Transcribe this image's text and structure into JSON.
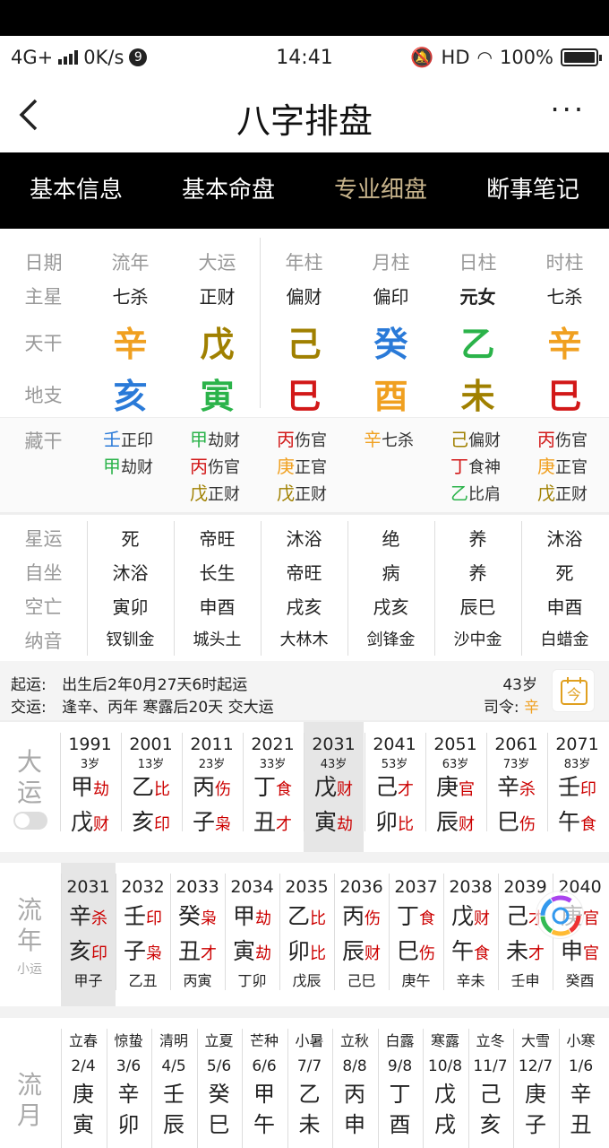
{
  "status": {
    "network": "4G+",
    "speed": "0K/s",
    "badge": "9",
    "time": "14:41",
    "hd": "HD",
    "battery": "100%"
  },
  "header": {
    "title": "八字排盘",
    "back": "<",
    "more": "···"
  },
  "tabs": [
    "基本信息",
    "基本命盘",
    "专业细盘",
    "断事笔记"
  ],
  "colors": {
    "active_tab": "#c8b48c",
    "metal": "#f0a020",
    "earth": "#a08000",
    "water": "#2a7ad8",
    "wood": "#2bb34a",
    "fire": "#d21818",
    "highlight": "#e6e6e6"
  },
  "row_labels": [
    "日期",
    "主星",
    "天干",
    "地支"
  ],
  "columns": [
    {
      "head": "流年",
      "star": "七杀",
      "gan": "辛",
      "gan_color": "#f0a020",
      "zhi": "亥",
      "zhi_color": "#2a7ad8"
    },
    {
      "head": "大运",
      "star": "正财",
      "gan": "戊",
      "gan_color": "#a08000",
      "zhi": "寅",
      "zhi_color": "#2bb34a"
    },
    {
      "head": "年柱",
      "star": "偏财",
      "gan": "己",
      "gan_color": "#a08000",
      "zhi": "巳",
      "zhi_color": "#d21818"
    },
    {
      "head": "月柱",
      "star": "偏印",
      "gan": "癸",
      "gan_color": "#2a7ad8",
      "zhi": "酉",
      "zhi_color": "#f0a020"
    },
    {
      "head": "日柱",
      "star": "元女",
      "gan": "乙",
      "gan_color": "#2bb34a",
      "zhi": "未",
      "zhi_color": "#a08000"
    },
    {
      "head": "时柱",
      "star": "七杀",
      "gan": "辛",
      "gan_color": "#f0a020",
      "zhi": "巳",
      "zhi_color": "#d21818"
    }
  ],
  "hidden_label": "藏干",
  "hidden": [
    [
      {
        "g": "壬",
        "c": "#2a7ad8",
        "s": "正印"
      },
      {
        "g": "甲",
        "c": "#2bb34a",
        "s": "劫财"
      }
    ],
    [
      {
        "g": "甲",
        "c": "#2bb34a",
        "s": "劫财"
      },
      {
        "g": "丙",
        "c": "#d21818",
        "s": "伤官"
      },
      {
        "g": "戊",
        "c": "#a08000",
        "s": "正财"
      }
    ],
    [
      {
        "g": "丙",
        "c": "#d21818",
        "s": "伤官"
      },
      {
        "g": "庚",
        "c": "#f0a020",
        "s": "正官"
      },
      {
        "g": "戊",
        "c": "#a08000",
        "s": "正财"
      }
    ],
    [
      {
        "g": "辛",
        "c": "#f0a020",
        "s": "七杀"
      }
    ],
    [
      {
        "g": "己",
        "c": "#a08000",
        "s": "偏财"
      },
      {
        "g": "丁",
        "c": "#d21818",
        "s": "食神"
      },
      {
        "g": "乙",
        "c": "#2bb34a",
        "s": "比肩"
      }
    ],
    [
      {
        "g": "丙",
        "c": "#d21818",
        "s": "伤官"
      },
      {
        "g": "庚",
        "c": "#f0a020",
        "s": "正官"
      },
      {
        "g": "戊",
        "c": "#a08000",
        "s": "正财"
      }
    ]
  ],
  "star_labels": [
    "星运",
    "自坐",
    "空亡",
    "纳音"
  ],
  "star_rows": [
    [
      "死",
      "帝旺",
      "沐浴",
      "绝",
      "养",
      "沐浴"
    ],
    [
      "沐浴",
      "长生",
      "帝旺",
      "病",
      "养",
      "死"
    ],
    [
      "寅卯",
      "申酉",
      "戌亥",
      "戌亥",
      "辰巳",
      "申酉"
    ],
    [
      "钗钏金",
      "城头土",
      "大林木",
      "剑锋金",
      "沙中金",
      "白蜡金"
    ]
  ],
  "qiyun": {
    "label1": "起运:",
    "text1": "出生后2年0月27天6时起运",
    "label2": "交运:",
    "text2": "逢辛、丙年 寒露后20天 交大运",
    "age": "43岁",
    "siling_label": "司令:",
    "siling": "辛",
    "today_icon": "今"
  },
  "dayun_label": [
    "大",
    "运"
  ],
  "dayun": [
    {
      "y": "1991",
      "a": "3岁",
      "g": "甲",
      "gs": "劫",
      "z": "戊",
      "zs": "财"
    },
    {
      "y": "2001",
      "a": "13岁",
      "g": "乙",
      "gs": "比",
      "z": "亥",
      "zs": "印"
    },
    {
      "y": "2011",
      "a": "23岁",
      "g": "丙",
      "gs": "伤",
      "z": "子",
      "zs": "枭"
    },
    {
      "y": "2021",
      "a": "33岁",
      "g": "丁",
      "gs": "食",
      "z": "丑",
      "zs": "才"
    },
    {
      "y": "2031",
      "a": "43岁",
      "g": "戊",
      "gs": "财",
      "z": "寅",
      "zs": "劫"
    },
    {
      "y": "2041",
      "a": "53岁",
      "g": "己",
      "gs": "才",
      "z": "卯",
      "zs": "比"
    },
    {
      "y": "2051",
      "a": "63岁",
      "g": "庚",
      "gs": "官",
      "z": "辰",
      "zs": "财"
    },
    {
      "y": "2061",
      "a": "73岁",
      "g": "辛",
      "gs": "杀",
      "z": "巳",
      "zs": "伤"
    },
    {
      "y": "2071",
      "a": "83岁",
      "g": "壬",
      "gs": "印",
      "z": "午",
      "zs": "食"
    }
  ],
  "liunian_label": [
    "流",
    "年"
  ],
  "liunian_sub": "小运",
  "liunian": [
    {
      "y": "2031",
      "g": "辛",
      "gs": "杀",
      "z": "亥",
      "zs": "印",
      "x": "甲子"
    },
    {
      "y": "2032",
      "g": "壬",
      "gs": "印",
      "z": "子",
      "zs": "枭",
      "x": "乙丑"
    },
    {
      "y": "2033",
      "g": "癸",
      "gs": "枭",
      "z": "丑",
      "zs": "才",
      "x": "丙寅"
    },
    {
      "y": "2034",
      "g": "甲",
      "gs": "劫",
      "z": "寅",
      "zs": "劫",
      "x": "丁卯"
    },
    {
      "y": "2035",
      "g": "乙",
      "gs": "比",
      "z": "卯",
      "zs": "比",
      "x": "戊辰"
    },
    {
      "y": "2036",
      "g": "丙",
      "gs": "伤",
      "z": "辰",
      "zs": "财",
      "x": "己巳"
    },
    {
      "y": "2037",
      "g": "丁",
      "gs": "食",
      "z": "巳",
      "zs": "伤",
      "x": "庚午"
    },
    {
      "y": "2038",
      "g": "戊",
      "gs": "财",
      "z": "午",
      "zs": "食",
      "x": "辛未"
    },
    {
      "y": "2039",
      "g": "己",
      "gs": "才",
      "z": "未",
      "zs": "才",
      "x": "壬申"
    },
    {
      "y": "2040",
      "g": "庚",
      "gs": "官",
      "z": "申",
      "zs": "官",
      "x": "癸酉"
    }
  ],
  "liuyue_label": [
    "流",
    "月"
  ],
  "liuyue": [
    {
      "t": "立春",
      "d": "2/4",
      "g": "庚",
      "z": "寅"
    },
    {
      "t": "惊蛰",
      "d": "3/6",
      "g": "辛",
      "z": "卯"
    },
    {
      "t": "清明",
      "d": "4/5",
      "g": "壬",
      "z": "辰"
    },
    {
      "t": "立夏",
      "d": "5/6",
      "g": "癸",
      "z": "巳"
    },
    {
      "t": "芒种",
      "d": "6/6",
      "g": "甲",
      "z": "午"
    },
    {
      "t": "小暑",
      "d": "7/7",
      "g": "乙",
      "z": "未"
    },
    {
      "t": "立秋",
      "d": "8/8",
      "g": "丙",
      "z": "申"
    },
    {
      "t": "白露",
      "d": "9/8",
      "g": "丁",
      "z": "酉"
    },
    {
      "t": "寒露",
      "d": "10/8",
      "g": "戊",
      "z": "戌"
    },
    {
      "t": "立冬",
      "d": "11/7",
      "g": "己",
      "z": "亥"
    },
    {
      "t": "大雪",
      "d": "12/7",
      "g": "庚",
      "z": "子"
    },
    {
      "t": "小寒",
      "d": "1/6",
      "g": "辛",
      "z": "丑"
    }
  ]
}
